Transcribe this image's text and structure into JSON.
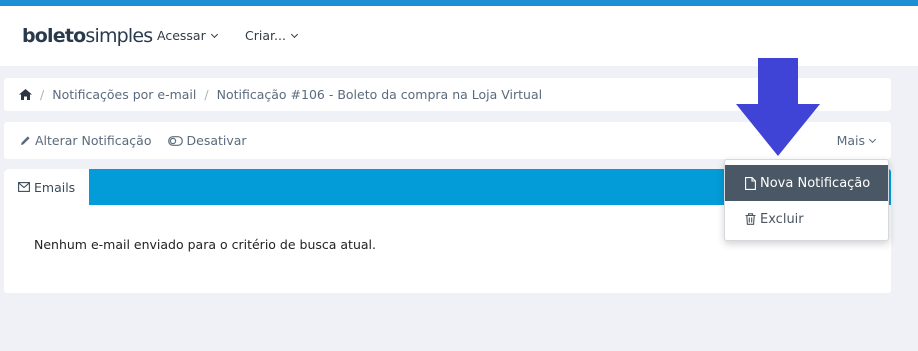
{
  "brand": {
    "logo_bold": "boleto",
    "logo_light": "simples"
  },
  "nav": {
    "acessar": "Acessar",
    "criar": "Criar..."
  },
  "breadcrumb": {
    "item1": "Notificações por e-mail",
    "item2": "Notificação #106 - Boleto da compra na Loja Virtual",
    "separator": "/"
  },
  "toolbar": {
    "alterar": "Alterar Notificação",
    "desativar": "Desativar",
    "mais": "Mais"
  },
  "tabs": {
    "emails": "Emails"
  },
  "content": {
    "empty": "Nenhum e-mail enviado para o critério de busca atual."
  },
  "dropdown": {
    "nova": "Nova Notificação",
    "excluir": "Excluir"
  },
  "colors": {
    "accent": "#049cd8",
    "top_stripe": "#1e8fd5",
    "dropdown_active": "#4a5866",
    "annotation_arrow": "#3f44d6"
  },
  "icons": [
    "home-icon",
    "pencil-icon",
    "toggle-icon",
    "envelope-icon",
    "file-icon",
    "trash-icon",
    "chevron-down-icon"
  ]
}
